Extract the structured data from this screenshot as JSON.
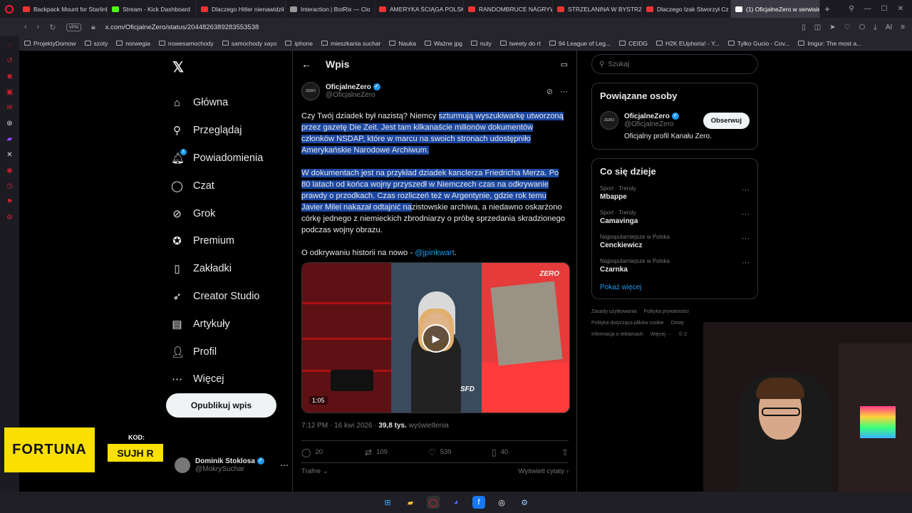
{
  "tabs": [
    {
      "title": "Backpack Mount for Starlink",
      "color": "#e33"
    },
    {
      "title": "Stream - Kick Dashboard",
      "color": "#53fc18"
    },
    {
      "title": "Dlaczego Hitler nienawidził",
      "color": "#e33"
    },
    {
      "title": "Interaction | BotRix — Clo",
      "color": "#999"
    },
    {
      "title": "AMERYKA ŚCIĄGA POLSK",
      "color": "#e33"
    },
    {
      "title": "RANDOMBRUCE NAGRYW",
      "color": "#e33"
    },
    {
      "title": "STRZELANINA W BYSTRZ",
      "color": "#e33"
    },
    {
      "title": "Dlaczego Izak Stworzył Cz",
      "color": "#e33"
    },
    {
      "title": "(1) OficjalneZero w serwisie",
      "color": "#fff",
      "active": true
    }
  ],
  "address": {
    "vpn": "VPN",
    "url": "x.com/OficjalneZero/status/2044826389283553538"
  },
  "bookmarks": [
    "ProjektyDomow",
    "szoty",
    "norwegia",
    "nowesamochody",
    "samochody xayo",
    "iphone",
    "mieszkania suchar",
    "Nauka",
    "Ważne jpg",
    "nuty",
    "tweety do rt",
    "94 League of Leg...",
    "CEIDG",
    "H2K EUphoria! - Y...",
    "Tylko Gucio - Cov...",
    "Imgur: The most a..."
  ],
  "nav": {
    "items": [
      {
        "label": "Główna",
        "icon": "home-icon",
        "glyph": "⌂"
      },
      {
        "label": "Przeglądaj",
        "icon": "search-icon",
        "glyph": "⚲"
      },
      {
        "label": "Powiadomienia",
        "icon": "bell-icon",
        "glyph": "🔔︎",
        "badge": "1"
      },
      {
        "label": "Czat",
        "icon": "chat-icon",
        "glyph": "◯"
      },
      {
        "label": "Grok",
        "icon": "grok-icon",
        "glyph": "⊘"
      },
      {
        "label": "Premium",
        "icon": "premium-icon",
        "glyph": "✪"
      },
      {
        "label": "Zakładki",
        "icon": "bookmark-icon",
        "glyph": "▯"
      },
      {
        "label": "Creator Studio",
        "icon": "rocket-icon",
        "glyph": "➶"
      },
      {
        "label": "Artykuły",
        "icon": "articles-icon",
        "glyph": "▤"
      },
      {
        "label": "Profil",
        "icon": "profile-icon",
        "glyph": "👤︎"
      },
      {
        "label": "Więcej",
        "icon": "more-icon",
        "glyph": "⋯"
      }
    ],
    "post_button": "Opublikuj wpis",
    "account": {
      "name": "Dominik Stoklosa",
      "handle": "@MokrySuchar"
    }
  },
  "promo": {
    "brand": "FORTUNA",
    "code_label": "KOD:",
    "code_value": "SUJH R"
  },
  "post": {
    "header_title": "Wpis",
    "author_name": "OficjalneZero",
    "author_handle": "@OficjalneZero",
    "avatar_text": "ZERO",
    "p1_plain": "Czy Twój dziadek był nazistą? Niemcy ",
    "p1_hl": "szturmują wyszukiwarkę utworzoną przez gazetę Die Zeit. Jest tam kilkanaście milionów dokumentów członków NSDAP, które w marcu na swoich stronach udostępniło Amerykańskie Narodowe Archiwum.",
    "p2_hl": "W dokumentach jest na przykład dziadek kanclerza Friedricha Merza. Po 80 latach od końca wojny przyszedł w Niemczech czas na odkrywanie prawdy o przodkach. Czas rozliczeń też w Argentynie, gdzie rok temu Javier Milei nakazał odtajnić na",
    "p2_plain": "zistowskie archiwa, a niedawno oskarżono córkę jednego z niemieckich zbrodniarzy o próbę sprzedania skradzionego podczas wojny obrazu.",
    "p3_plain": "O odkrywaniu historii na nowo - ",
    "p3_link": "@jpinkwart",
    "p3_end": ".",
    "video_duration": "1:05",
    "video_logo": "ZERO",
    "video_sfd": "SFD",
    "time": "7:12 PM · 16 kwi 2026 · ",
    "views_count": "39,8 tys.",
    "views_label": " wyświetlenia",
    "replies": "20",
    "reposts": "109",
    "likes": "539",
    "bookmarks": "40",
    "sort_label": "Trafne",
    "quotes_link": "Wyświetl cytaty"
  },
  "sidebar": {
    "search_placeholder": "Szukaj",
    "related_title": "Powiązane osoby",
    "related": {
      "name": "OficjalneZero",
      "handle": "@OficjalneZero",
      "follow": "Obserwuj",
      "bio": "Oficjalny profil Kanału Zero."
    },
    "trends_title": "Co się dzieje",
    "trends": [
      {
        "category": "Sport · Trendy",
        "name": "Mbappe"
      },
      {
        "category": "Sport · Trendy",
        "name": "Camavinga"
      },
      {
        "category": "Najpopularniejsze w Polska",
        "name": "Cenckiewicz"
      },
      {
        "category": "Najpopularniejsze w Polska",
        "name": "Czarnka"
      }
    ],
    "show_more": "Pokaż więcej",
    "footer": [
      "Zasady użytkowania",
      "Polityka prywatności",
      "Polityka dotycząca plików cookie",
      "Dostę",
      "Informacja o reklamach",
      "Więcej ···",
      "© 2"
    ]
  }
}
